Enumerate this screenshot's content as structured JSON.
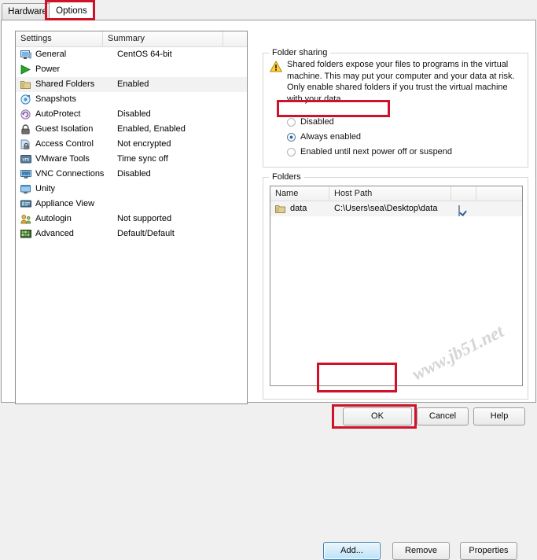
{
  "window": {
    "tabs": [
      {
        "label": "Hardware",
        "active": false
      },
      {
        "label": "Options",
        "active": true
      }
    ],
    "accent_red": "#cf1228",
    "watermark": "www.jb51.net"
  },
  "settings_list": {
    "columns": [
      "Settings",
      "Summary",
      ""
    ],
    "rows": [
      {
        "icon": "monitor-icon",
        "name": "General",
        "summary": "CentOS 64-bit",
        "selected": false
      },
      {
        "icon": "play-triangle-icon",
        "name": "Power",
        "summary": "",
        "selected": false
      },
      {
        "icon": "folder-icon",
        "name": "Shared Folders",
        "summary": "Enabled",
        "selected": true
      },
      {
        "icon": "camera-snapshot-icon",
        "name": "Snapshots",
        "summary": "",
        "selected": false
      },
      {
        "icon": "clock-revert-icon",
        "name": "AutoProtect",
        "summary": "Disabled",
        "selected": false
      },
      {
        "icon": "padlock-icon",
        "name": "Guest Isolation",
        "summary": "Enabled, Enabled",
        "selected": false
      },
      {
        "icon": "lock-document-icon",
        "name": "Access Control",
        "summary": "Not encrypted",
        "selected": false
      },
      {
        "icon": "vmware-tools-icon",
        "name": "VMware Tools",
        "summary": "Time sync off",
        "selected": false
      },
      {
        "icon": "vnc-monitor-icon",
        "name": "VNC Connections",
        "summary": "Disabled",
        "selected": false
      },
      {
        "icon": "unity-window-icon",
        "name": "Unity",
        "summary": "",
        "selected": false
      },
      {
        "icon": "appliance-view-icon",
        "name": "Appliance View",
        "summary": "",
        "selected": false
      },
      {
        "icon": "users-key-icon",
        "name": "Autologin",
        "summary": "Not supported",
        "selected": false
      },
      {
        "icon": "advanced-grid-icon",
        "name": "Advanced",
        "summary": "Default/Default",
        "selected": false
      }
    ]
  },
  "folder_sharing": {
    "group_title": "Folder sharing",
    "warning_icon": "warning-triangle-icon",
    "warning_text": "Shared folders expose your files to programs in the virtual machine. This may put your computer and your data at risk. Only enable shared folders if you trust the virtual machine with your data.",
    "options": [
      {
        "label": "Disabled",
        "selected": false
      },
      {
        "label": "Always enabled",
        "selected": true
      },
      {
        "label": "Enabled until next power off or suspend",
        "selected": false
      }
    ]
  },
  "folders": {
    "group_title": "Folders",
    "columns": [
      "Name",
      "Host Path",
      "",
      ""
    ],
    "rows": [
      {
        "icon": "folder-icon",
        "name": "data",
        "host_path": "C:\\Users\\sea\\Desktop\\data",
        "enabled": true
      }
    ],
    "buttons": {
      "add": "Add...",
      "remove": "Remove",
      "properties": "Properties"
    }
  },
  "dialog_buttons": {
    "ok": "OK",
    "cancel": "Cancel",
    "help": "Help"
  }
}
